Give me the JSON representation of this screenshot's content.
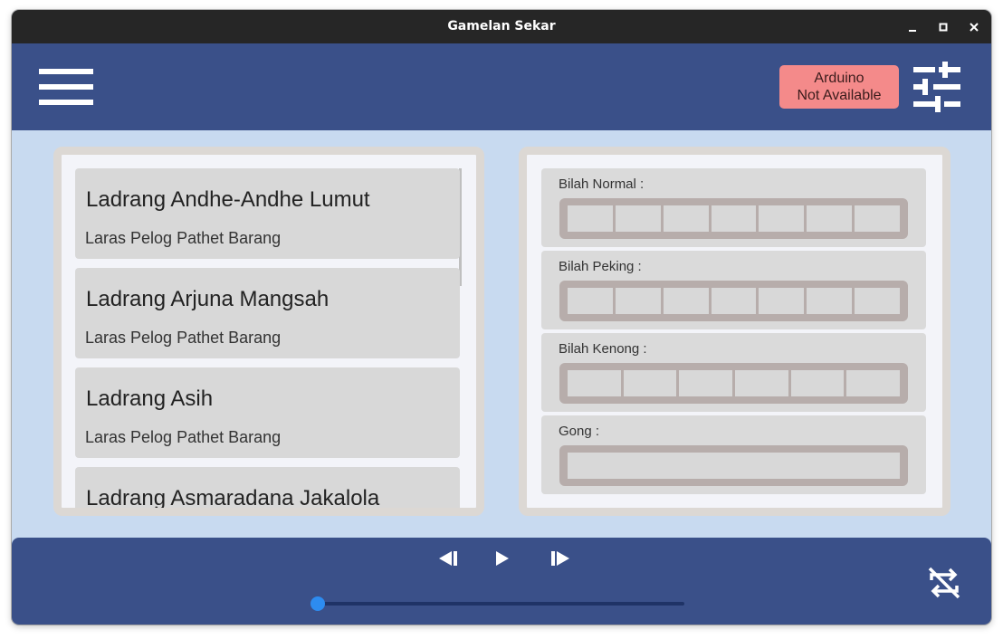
{
  "window": {
    "title": "Gamelan Sekar",
    "controls": [
      "minimize-icon",
      "maximize-icon",
      "close-icon"
    ]
  },
  "appbar": {
    "menu_icon": "menu-icon",
    "arduino_status": {
      "line1": "Arduino",
      "line2": "Not Available",
      "color": "#f48a8a"
    },
    "settings_icon": "tune-icon"
  },
  "songs": [
    {
      "name": "Ladrang Andhe-Andhe Lumut",
      "laras": "Laras Pelog Pathet Barang"
    },
    {
      "name": "Ladrang Arjuna Mangsah",
      "laras": "Laras Pelog Pathet Barang"
    },
    {
      "name": "Ladrang Asih",
      "laras": "Laras Pelog Pathet Barang"
    },
    {
      "name": "Ladrang Asmaradana Jakalola",
      "laras": ""
    }
  ],
  "bilah": {
    "normal": {
      "label": "Bilah Normal :",
      "keys": 7
    },
    "peking": {
      "label": "Bilah Peking :",
      "keys": 7
    },
    "kenong": {
      "label": "Bilah Kenong :",
      "keys": 6
    },
    "gong": {
      "label": "Gong :",
      "keys": 1
    }
  },
  "player": {
    "prev_icon": "skip-previous-icon",
    "play_icon": "play-icon",
    "next_icon": "skip-next-icon",
    "repeat_icon": "repeat-off-icon",
    "progress": 0.0,
    "accent": "#2d8cf0"
  },
  "colors": {
    "appbar": "#3a5089",
    "background": "#c8daf0",
    "key_frame": "#b7adab"
  }
}
